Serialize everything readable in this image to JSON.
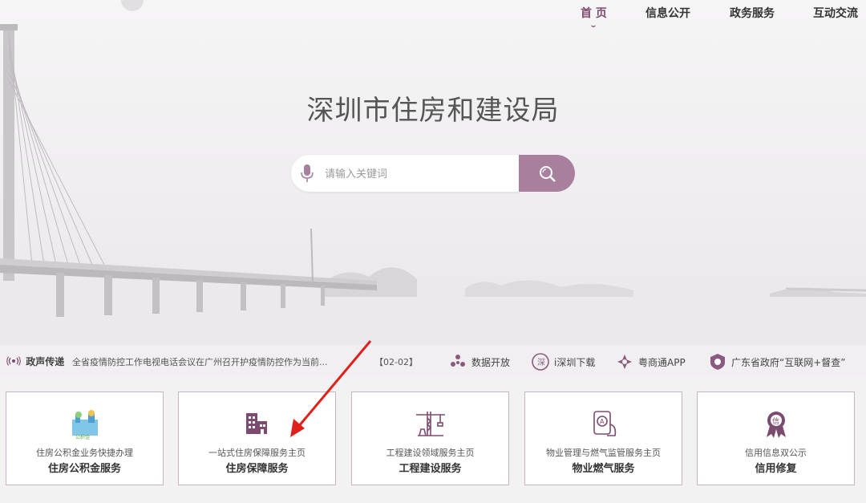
{
  "nav": {
    "items": [
      {
        "label": "首 页",
        "active": true
      },
      {
        "label": "信息公开"
      },
      {
        "label": "政务服务"
      },
      {
        "label": "互动交流"
      }
    ]
  },
  "header": {
    "title": "深圳市住房和建设局"
  },
  "search": {
    "placeholder": "请输入关键词",
    "icon": "microphone-icon",
    "button_icon": "search-icon",
    "accent": "#a97f9e"
  },
  "ticker": {
    "label": "政声传递",
    "headline": "全省疫情防控工作电视电话会议在广州召开护疫情防控作为当前...",
    "date": "【02-02】"
  },
  "quick_links": [
    {
      "label": "数据开放",
      "icon": "data-icon"
    },
    {
      "label": "i深圳下载",
      "icon": "i-shenzhen-icon"
    },
    {
      "label": "粤商通APP",
      "icon": "yueshangtong-icon"
    },
    {
      "label": "广东省政府“互联网+督查”",
      "icon": "supervision-icon"
    }
  ],
  "cards": [
    {
      "sub": "住房公积金业务快捷办理",
      "main": "住房公积金服务",
      "icon": "housing-fund-icon"
    },
    {
      "sub": "一站式住房保障服务主页",
      "main": "住房保障服务",
      "icon": "building-icon"
    },
    {
      "sub": "工程建设领域服务主页",
      "main": "工程建设服务",
      "icon": "crane-icon"
    },
    {
      "sub": "物业管理与燃气监管服务主页",
      "main": "物业燃气服务",
      "icon": "gas-meter-icon"
    },
    {
      "sub": "信用信息双公示",
      "main": "信用修复",
      "icon": "credit-badge-icon"
    }
  ],
  "colors": {
    "brand": "#7d4a70",
    "accent": "#a97f9e",
    "annotation_arrow": "#e0201b"
  }
}
